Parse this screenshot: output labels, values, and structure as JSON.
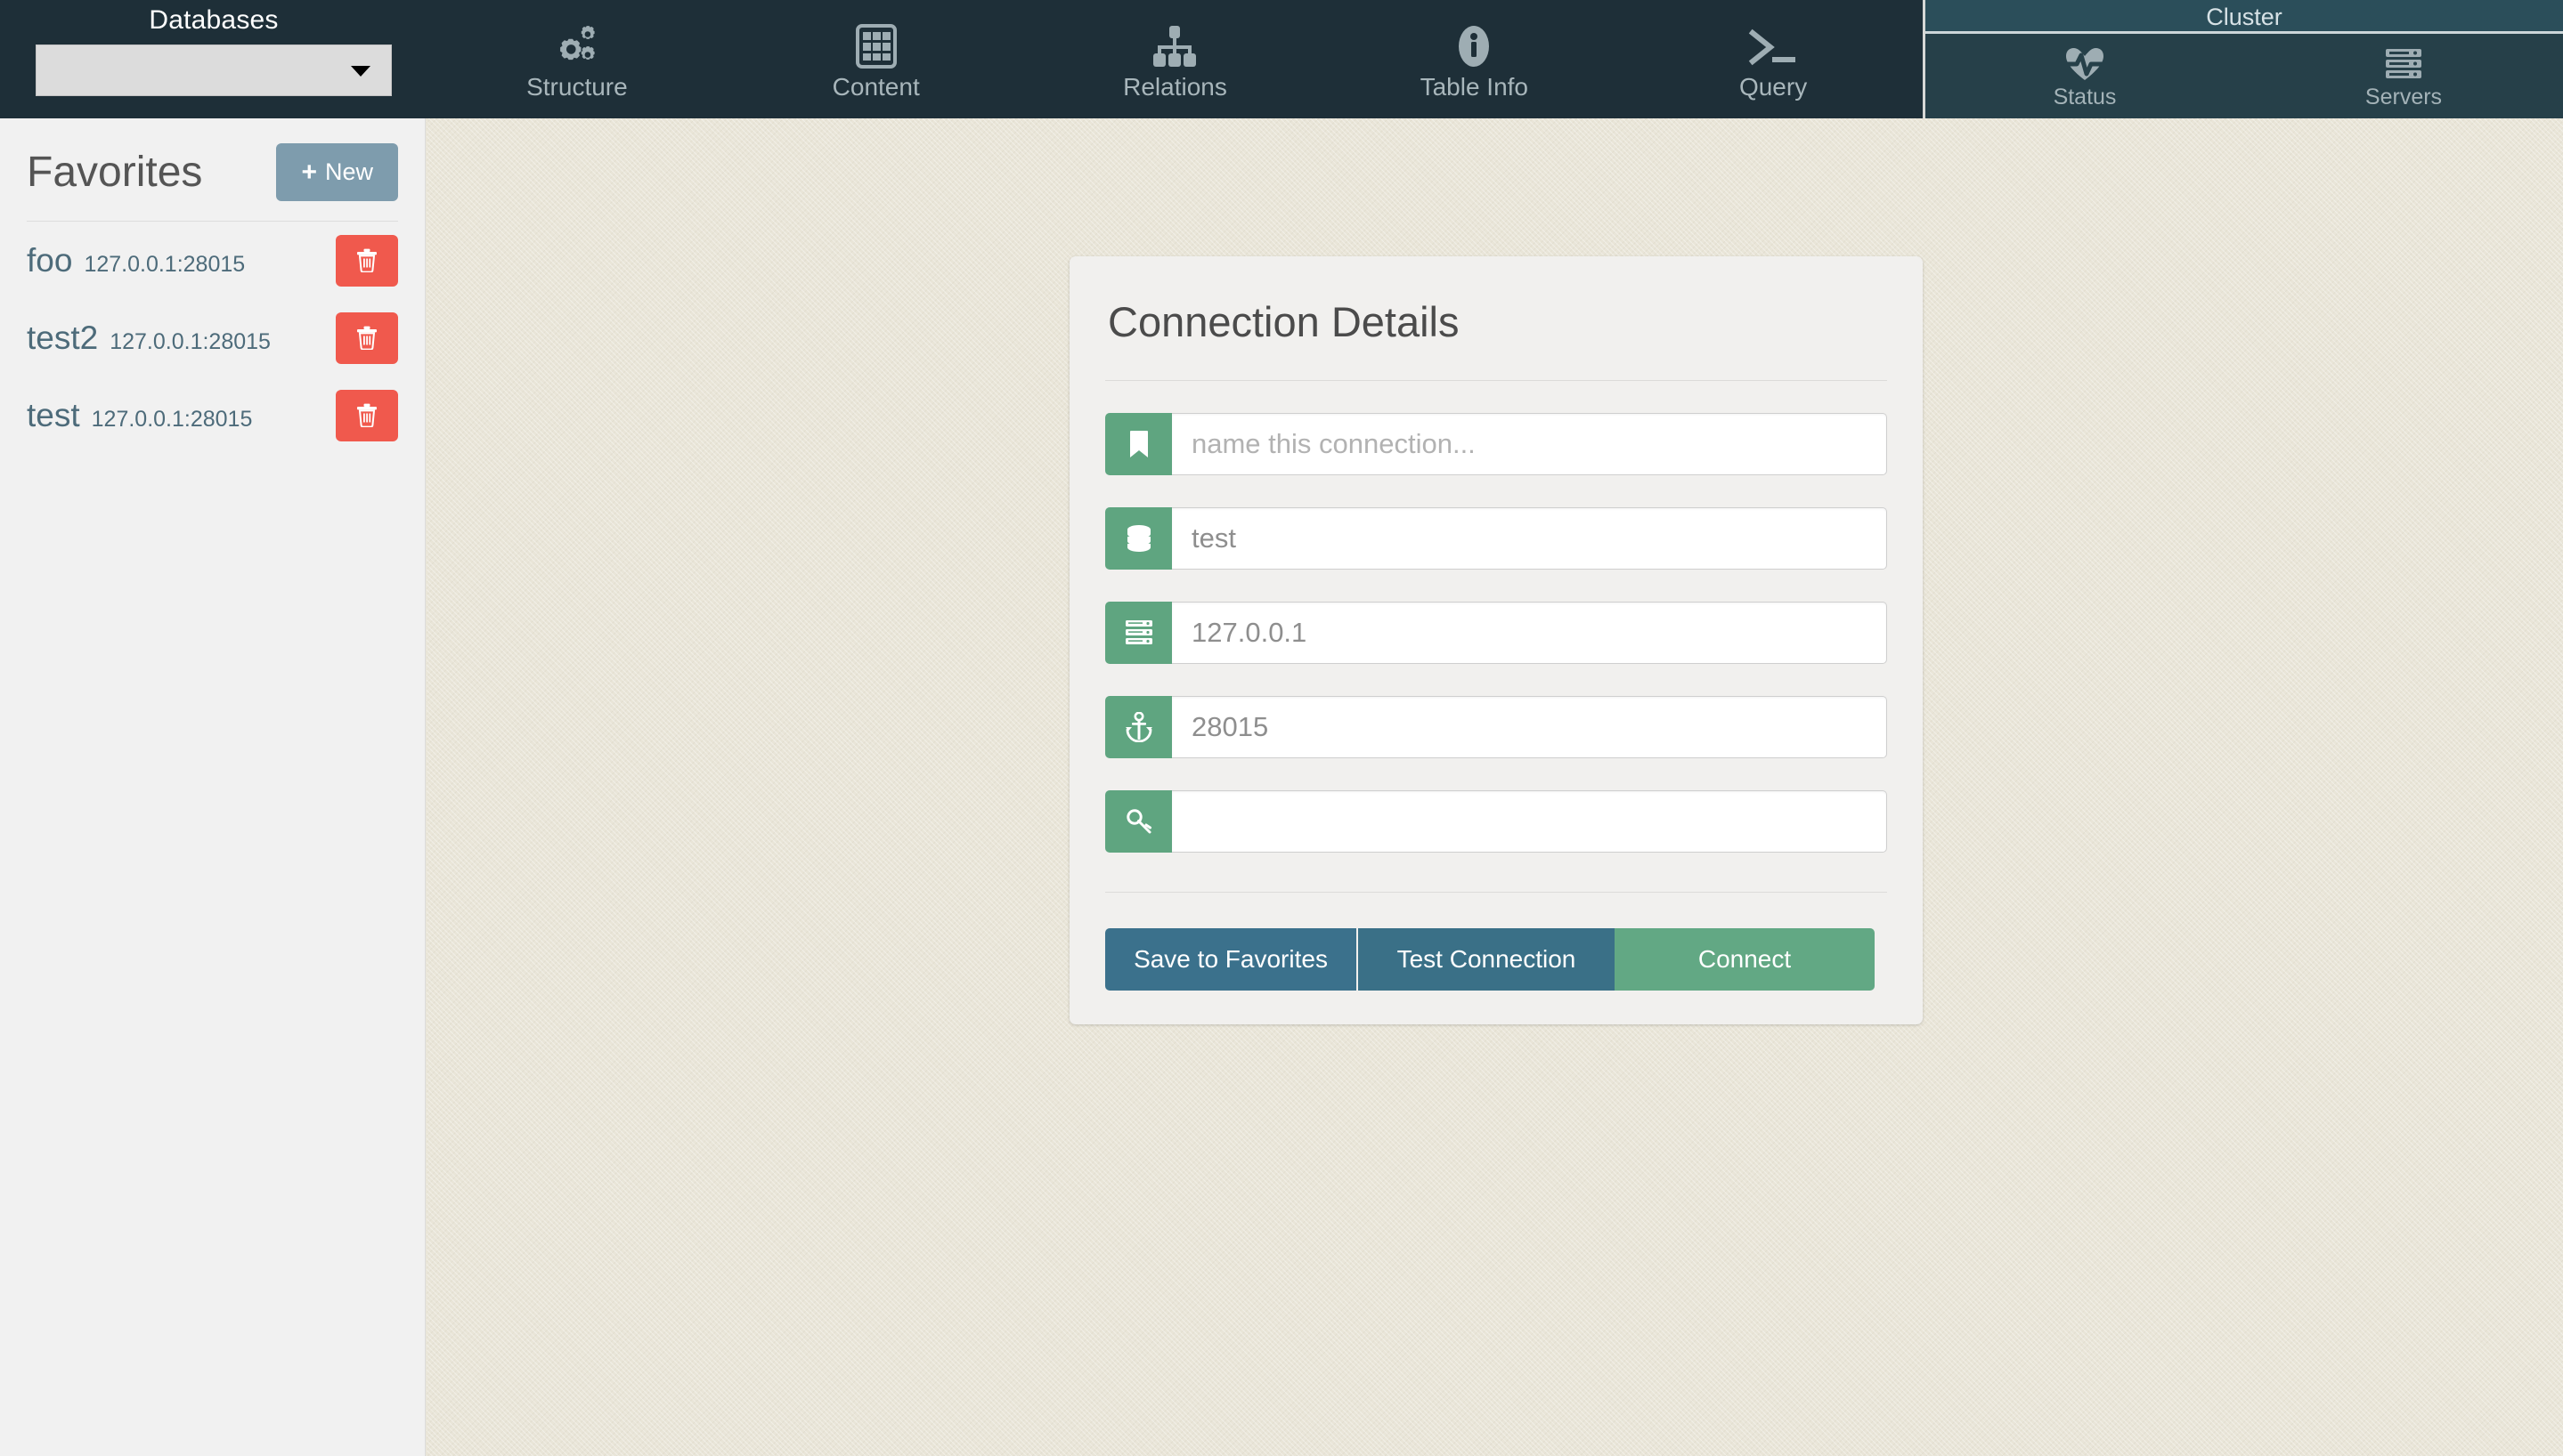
{
  "topbar": {
    "databases": {
      "label": "Databases",
      "selected": "",
      "placeholder": "",
      "caret_icon": "caret-down-icon"
    },
    "nav_items": [
      {
        "label": "Structure",
        "icon": "gears-icon"
      },
      {
        "label": "Content",
        "icon": "table-grid-icon"
      },
      {
        "label": "Relations",
        "icon": "sitemap-icon"
      },
      {
        "label": "Table Info",
        "icon": "info-circle-icon"
      },
      {
        "label": "Query",
        "icon": "terminal-prompt-icon"
      }
    ],
    "cluster": {
      "title": "Cluster",
      "items": [
        {
          "label": "Status",
          "icon": "heartbeat-icon"
        },
        {
          "label": "Servers",
          "icon": "server-rack-icon"
        }
      ]
    }
  },
  "sidebar": {
    "title": "Favorites",
    "new_button": {
      "plus": "+",
      "label": "New"
    },
    "favorites": [
      {
        "name": "foo",
        "host": "127.0.0.1:28015",
        "delete_icon": "trash-icon"
      },
      {
        "name": "test2",
        "host": "127.0.0.1:28015",
        "delete_icon": "trash-icon"
      },
      {
        "name": "test",
        "host": "127.0.0.1:28015",
        "delete_icon": "trash-icon"
      }
    ]
  },
  "connection_card": {
    "title": "Connection Details",
    "fields": [
      {
        "icon": "bookmark-icon",
        "name": "connection-name",
        "value": "",
        "placeholder": "name this connection..."
      },
      {
        "icon": "database-icon",
        "name": "database-name",
        "value": "test",
        "placeholder": ""
      },
      {
        "icon": "server-icon",
        "name": "host",
        "value": "127.0.0.1",
        "placeholder": ""
      },
      {
        "icon": "anchor-icon",
        "name": "port",
        "value": "28015",
        "placeholder": ""
      },
      {
        "icon": "key-icon",
        "name": "auth-key",
        "value": "",
        "placeholder": ""
      }
    ],
    "buttons": {
      "save": "Save to Favorites",
      "test": "Test Connection",
      "connect": "Connect"
    }
  },
  "colors": {
    "navbar_bg": "#1e2f38",
    "cluster_header_bg": "#2b4e5a",
    "cluster_bg": "#264049",
    "sidebar_bg": "#f1f1f1",
    "main_bg": "#e9e5d8",
    "accent_green": "#5fa580",
    "accent_blue": "#3b718c",
    "danger_red": "#f0594d",
    "new_button_blue": "#7e9cad",
    "link_text": "#4d6b7a"
  }
}
